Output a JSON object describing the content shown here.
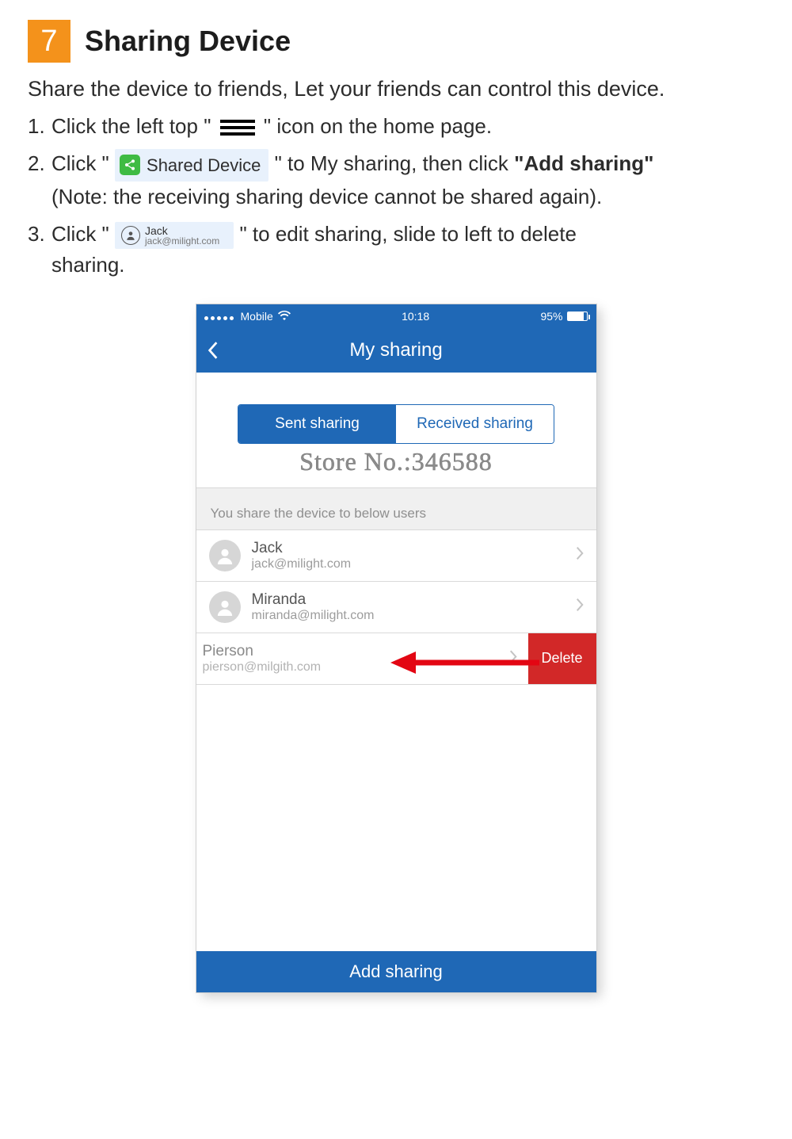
{
  "section_number": "7",
  "section_title": "Sharing Device",
  "intro": "Share the device to friends, Let your friends can control this device.",
  "steps": {
    "s1_a": "1.",
    "s1_b": "Click the left top \" ",
    "s1_c": " \" icon on the home page.",
    "s2_a": "2.",
    "s2_b": "Click \" ",
    "s2_chip": "Shared Device",
    "s2_c": " \" to My sharing, then click",
    "s2_bold": "\"Add sharing\"",
    "s2_note": "(Note: the receiving sharing device cannot be shared again).",
    "s3_a": "3.",
    "s3_b": "Click \" ",
    "s3_chip_name": "Jack",
    "s3_chip_mail": "jack@milight.com",
    "s3_c": " \" to edit sharing, slide to left to delete",
    "s3_d": "sharing."
  },
  "phone": {
    "carrier": "Mobile",
    "time": "10:18",
    "battery": "95%",
    "nav_title": "My sharing",
    "tabs": {
      "sent": "Sent sharing",
      "received": "Received sharing"
    },
    "strip": "You share the device to below users",
    "rows": [
      {
        "name": "Jack",
        "mail": "jack@milight.com"
      },
      {
        "name": "Miranda",
        "mail": "miranda@milight.com"
      }
    ],
    "swiped": {
      "name": "Pierson",
      "mail": "pierson@milgith.com",
      "delete": "Delete"
    },
    "footer": "Add sharing"
  },
  "watermark": "Store No.:346588"
}
